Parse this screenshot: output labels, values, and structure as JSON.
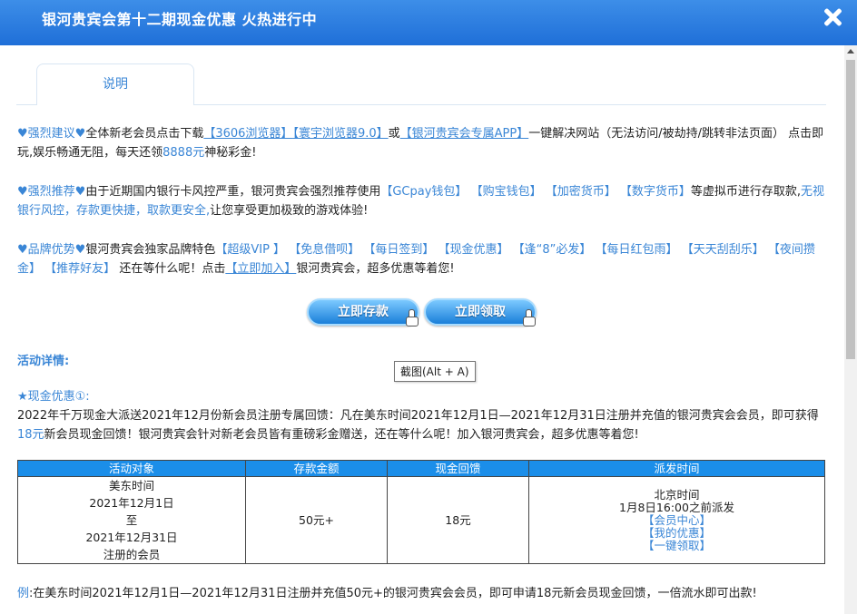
{
  "window": {
    "title": "银河贵宾会第十二期现金优惠 火热进行中"
  },
  "tabs": [
    {
      "label": "说明"
    }
  ],
  "notice1": {
    "heading": "强烈建议",
    "text1": "全体新老会员点击下载",
    "link1": "【3606浏览器】",
    "link2": "【寰宇浏览器9.0】",
    "or": "或",
    "link3": "【银河贵宾会专属APP】",
    "text2": "一键解决网站（无法访问/被劫持/跳转非法页面） 点击即玩,娱乐畅通无阻，每天还领",
    "amount": "8888元",
    "text3": "神秘彩金!"
  },
  "notice2": {
    "heading": "强烈推荐",
    "text1": "由于近期国内银行卡风控严重，银河贵宾会强烈推荐使用",
    "tags": [
      "【GCpay钱包】",
      "【购宝钱包】",
      "【加密货币】",
      "【数字货币】"
    ],
    "text2": "等虚拟币进行存取款,",
    "highlight": "无视银行风控，存款更快捷，取款更安全,",
    "text3": "让您享受更加极致的游戏体验!"
  },
  "notice3": {
    "heading": "品牌优势",
    "text1": "银河贵宾会独家品牌特色",
    "tags": [
      "【超级VIP 】",
      "【免息借呗】",
      "【每日签到】",
      "【现金优惠】",
      "【逢“8”必发】",
      "【每日红包雨】",
      "【天天刮刮乐】",
      "【夜间攒金】",
      "【推荐好友】"
    ],
    "text2": "还在等什么呢！点击",
    "join_link": "【立即加入】",
    "text3": "银河贵宾会，超多优惠等着您!"
  },
  "buttons": {
    "deposit": "立即存款",
    "claim": "立即领取"
  },
  "details": {
    "heading": "活动详情:",
    "tooltip": "截图(Alt + A)",
    "offer_title": "★现金优惠①:",
    "offer_text1": "2022年千万现金大派送2021年12月份新会员注册专属回馈：凡在美东时间2021年12月1日—2021年12月31日注册并充值的银河贵宾会会员，即可获得",
    "offer_amount": "18元",
    "offer_text2": "新会员现金回馈！银河贵宾会针对新老会员皆有重磅彩金赠送，还在等什么呢！加入银河贵宾会，超多优惠等着您!"
  },
  "table": {
    "headers": [
      "活动对象",
      "存款金额",
      "现金回馈",
      "派发时间"
    ],
    "target_lines": [
      "美东时间",
      "2021年12月1日",
      "至",
      "2021年12月31日",
      "注册的会员"
    ],
    "deposit": "50元+",
    "cashback": "18元",
    "dispatch_lines": [
      "北京时间",
      "1月8日16:00之前派发"
    ],
    "dispatch_links": [
      "【会员中心】",
      "【我的优惠】",
      "【一键领取】"
    ]
  },
  "example": {
    "label": "例",
    "text": ":在美东时间2021年12月1日—2021年12月31日注册并充值50元+的银河贵宾会会员，即可申请18元新会员现金回馈，一倍流水即可出款!"
  }
}
